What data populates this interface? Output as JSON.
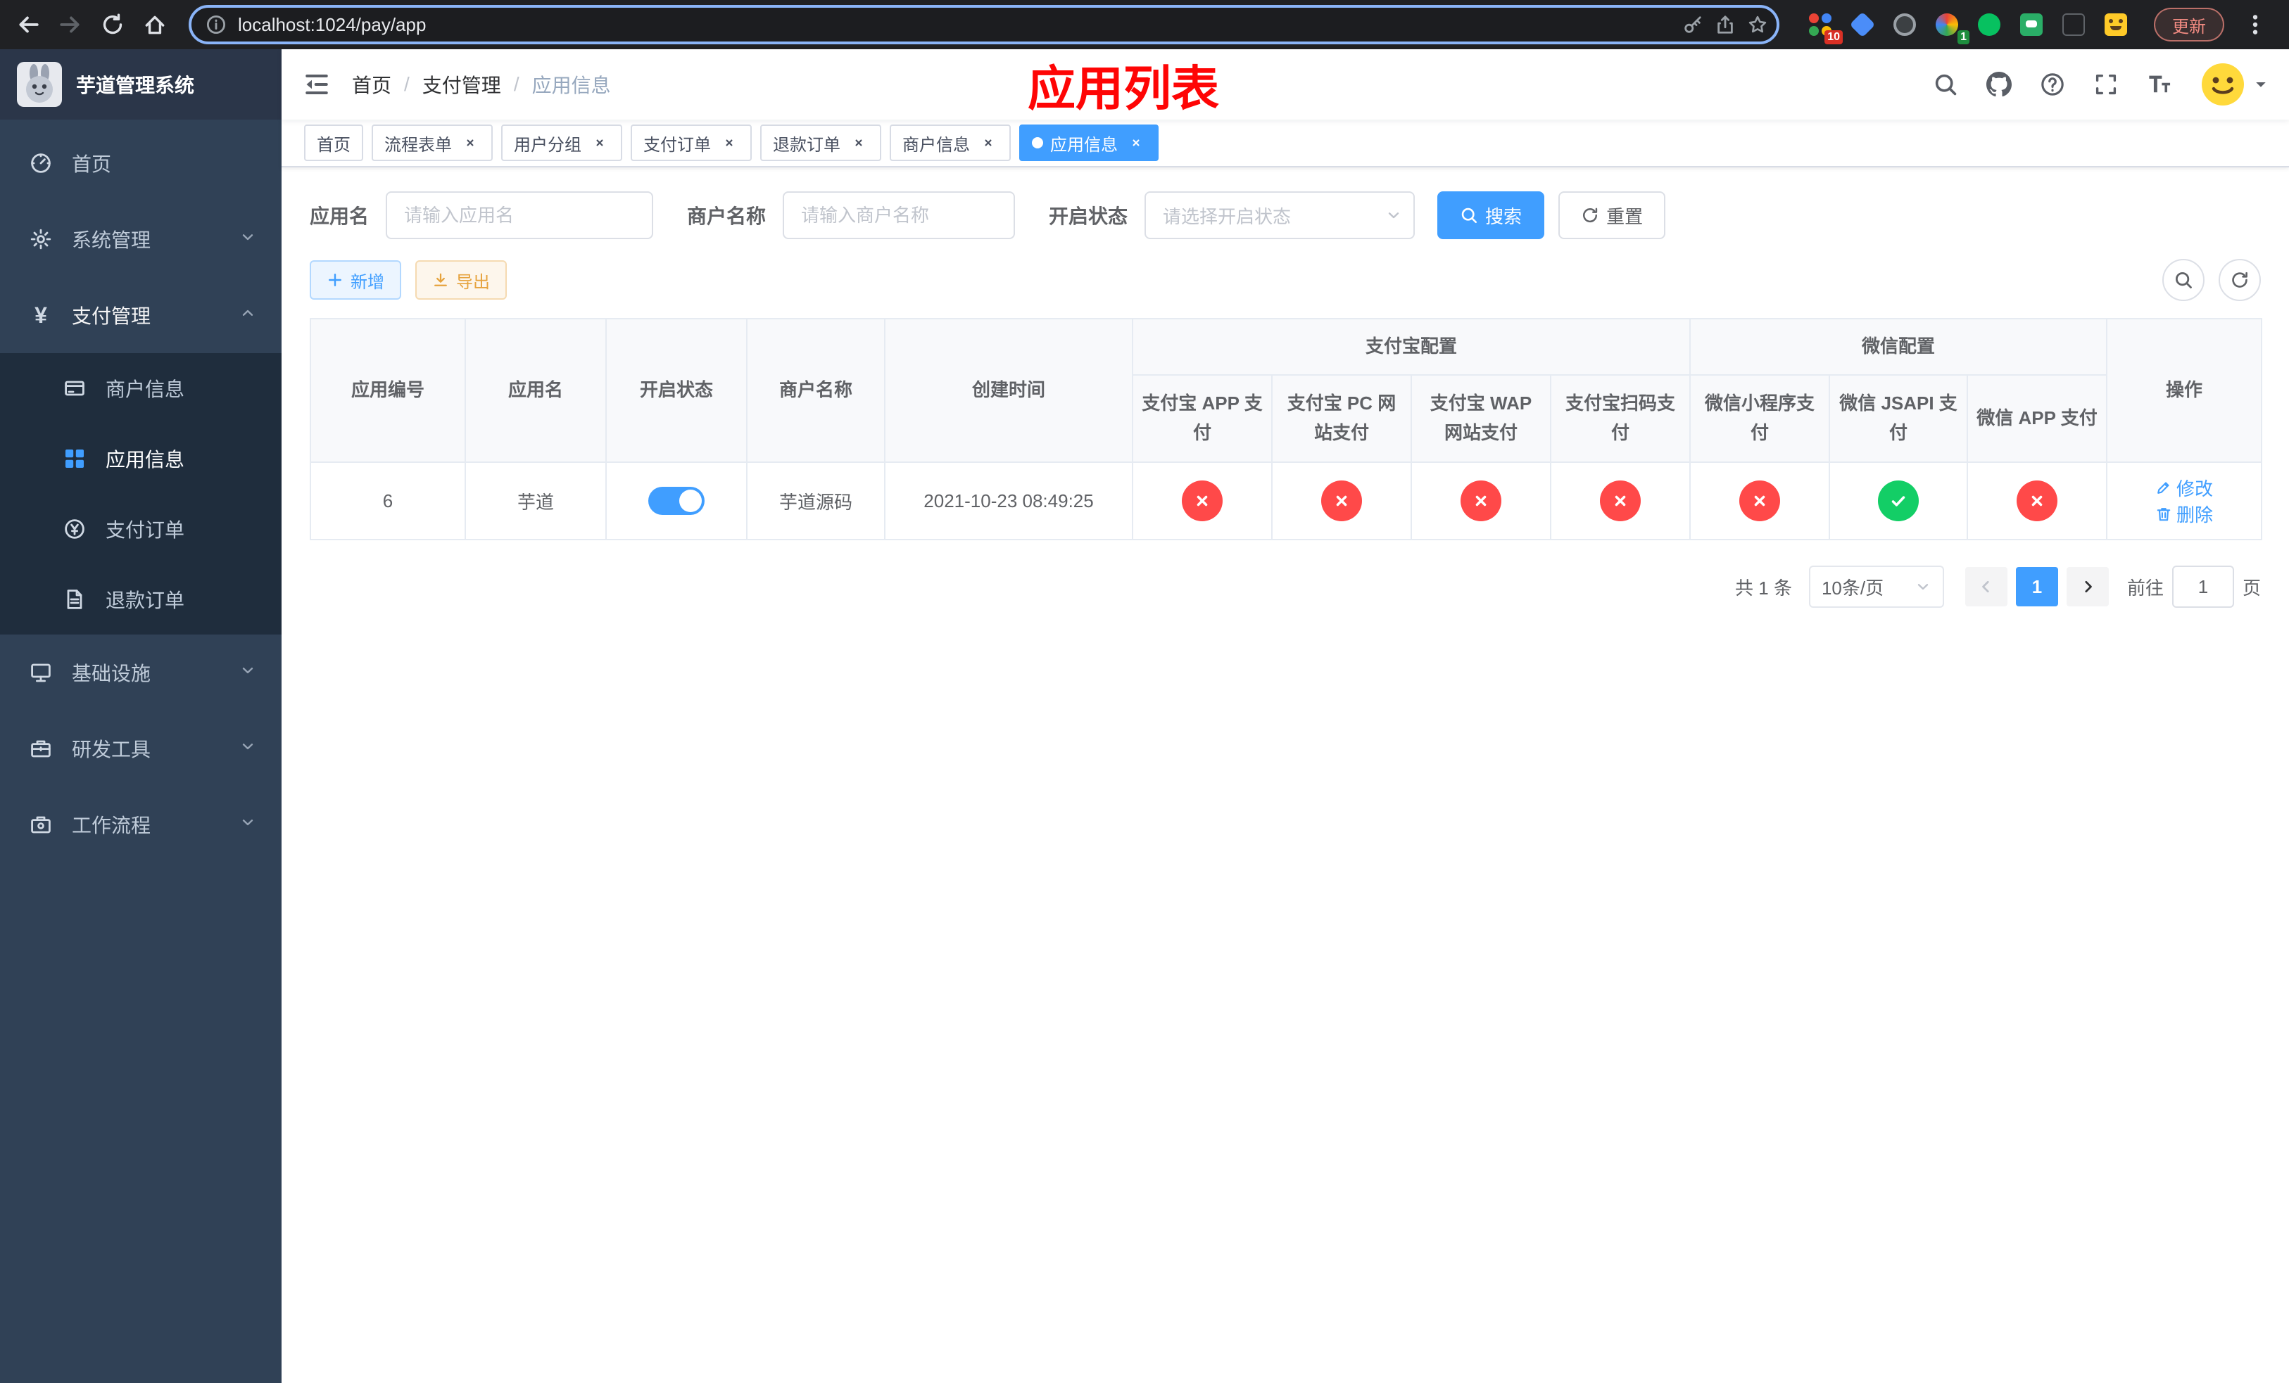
{
  "colors": {
    "primary": "#409eff",
    "success": "#13ce66",
    "danger": "#ff4949",
    "warning": "#e6a23c",
    "annotation_red": "#fe0505",
    "sidebar_bg": "#304156",
    "submenu_bg": "#1f2d3d"
  },
  "browser": {
    "url": "localhost:1024/pay/app",
    "update_label": "更新",
    "ext_badge_red": "10",
    "ext_badge_green": "1"
  },
  "sidebar": {
    "title": "芋道管理系统",
    "items": [
      {
        "key": "home",
        "icon": "dashboard-icon",
        "label": "首页",
        "expandable": false,
        "expanded": false
      },
      {
        "key": "system",
        "icon": "gear-icon",
        "label": "系统管理",
        "expandable": true,
        "expanded": false
      },
      {
        "key": "payment",
        "icon": "yen-icon",
        "label": "支付管理",
        "expandable": true,
        "expanded": true,
        "children": [
          {
            "key": "merchant-info",
            "icon": "bank-card-icon",
            "label": "商户信息",
            "active": false
          },
          {
            "key": "app-info",
            "icon": "grid-icon",
            "label": "应用信息",
            "active": true
          },
          {
            "key": "pay-order",
            "icon": "order-icon",
            "label": "支付订单",
            "active": false
          },
          {
            "key": "refund-order",
            "icon": "document-icon",
            "label": "退款订单",
            "active": false
          }
        ]
      },
      {
        "key": "infra",
        "icon": "monitor-icon",
        "label": "基础设施",
        "expandable": true,
        "expanded": false
      },
      {
        "key": "dev-tools",
        "icon": "toolbox-icon",
        "label": "研发工具",
        "expandable": true,
        "expanded": false
      },
      {
        "key": "workflow",
        "icon": "workflow-icon",
        "label": "工作流程",
        "expandable": true,
        "expanded": false
      }
    ]
  },
  "header": {
    "breadcrumb": [
      "首页",
      "支付管理",
      "应用信息"
    ],
    "annotation": "应用列表"
  },
  "tabs": [
    {
      "key": "home",
      "label": "首页",
      "closable": false,
      "active": false
    },
    {
      "key": "process-form",
      "label": "流程表单",
      "closable": true,
      "active": false
    },
    {
      "key": "user-group",
      "label": "用户分组",
      "closable": true,
      "active": false
    },
    {
      "key": "pay-order",
      "label": "支付订单",
      "closable": true,
      "active": false
    },
    {
      "key": "refund-order",
      "label": "退款订单",
      "closable": true,
      "active": false
    },
    {
      "key": "merchant-info",
      "label": "商户信息",
      "closable": true,
      "active": false
    },
    {
      "key": "app-info",
      "label": "应用信息",
      "closable": true,
      "active": true
    }
  ],
  "filters": {
    "app_name": {
      "label": "应用名",
      "placeholder": "请输入应用名"
    },
    "merchant_name": {
      "label": "商户名称",
      "placeholder": "请输入商户名称"
    },
    "status": {
      "label": "开启状态",
      "placeholder": "请选择开启状态"
    },
    "search_label": "搜索",
    "reset_label": "重置"
  },
  "toolbar": {
    "add_label": "新增",
    "export_label": "导出"
  },
  "table": {
    "simple_headers": [
      "应用编号",
      "应用名",
      "开启状态",
      "商户名称",
      "创建时间"
    ],
    "alipay_group": {
      "label": "支付宝配置",
      "children": [
        "支付宝 APP 支付",
        "支付宝 PC 网站支付",
        "支付宝 WAP 网站支付",
        "支付宝扫码支付"
      ]
    },
    "wechat_group": {
      "label": "微信配置",
      "children": [
        "微信小程序支付",
        "微信 JSAPI 支付",
        "微信 APP 支付"
      ]
    },
    "actions_header": "操作",
    "rows": [
      {
        "app_id": "6",
        "app_name": "芋道",
        "enabled": true,
        "merchant_name": "芋道源码",
        "create_time": "2021-10-23 08:49:25",
        "configs": {
          "alipay_app": false,
          "alipay_pc": false,
          "alipay_wap": false,
          "alipay_qr": false,
          "wechat_mini": false,
          "wechat_jsapi": true,
          "wechat_app": false
        },
        "actions": [
          {
            "key": "edit",
            "icon": "edit-icon",
            "label": "修改"
          },
          {
            "key": "delete",
            "icon": "trash-icon",
            "label": "删除"
          }
        ]
      }
    ]
  },
  "pagination": {
    "total_label": "共 1 条",
    "page_size_label": "10条/页",
    "current_page": "1",
    "goto_prefix": "前往",
    "goto_value": "1",
    "goto_suffix": "页"
  }
}
